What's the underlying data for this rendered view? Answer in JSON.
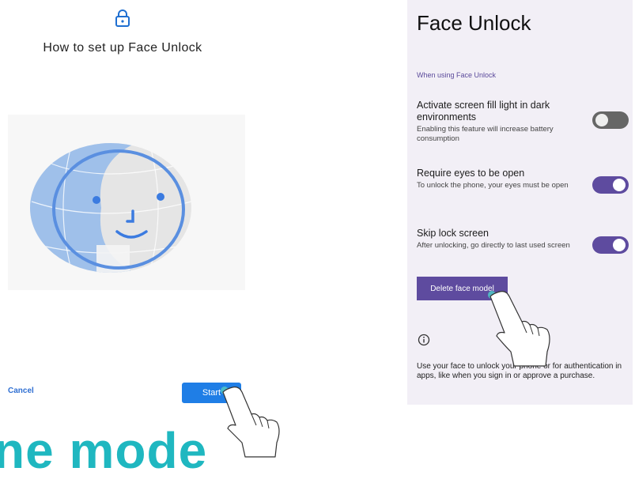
{
  "left": {
    "title": "How to set up Face Unlock",
    "cancel_label": "Cancel",
    "start_label": "Start",
    "bottom_partial_text": "ne mode",
    "icons": [
      "lock-icon",
      "face-illustration",
      "hand-pointer-icon"
    ],
    "colors": {
      "accent": "#1f7ee6",
      "cyan_text": "#1fb7c0"
    }
  },
  "right": {
    "title": "Face Unlock",
    "section_label": "When using Face Unlock",
    "settings": [
      {
        "title": "Activate screen fill light in dark environments",
        "subtitle": "Enabling this feature will increase battery consumption",
        "enabled": false
      },
      {
        "title": "Require eyes to be open",
        "subtitle": "To unlock the phone, your eyes must be open",
        "enabled": true
      },
      {
        "title": "Skip lock screen",
        "subtitle": "After unlocking, go directly to last used screen",
        "enabled": true
      }
    ],
    "delete_label": "Delete face model",
    "info_text": "Use your face to unlock your phone or for authentication in apps, like when you sign in or approve a purchase.",
    "icons": [
      "info-icon",
      "hand-pointer-icon"
    ],
    "colors": {
      "accent": "#5e4b9f",
      "background": "#f2eff6"
    }
  }
}
